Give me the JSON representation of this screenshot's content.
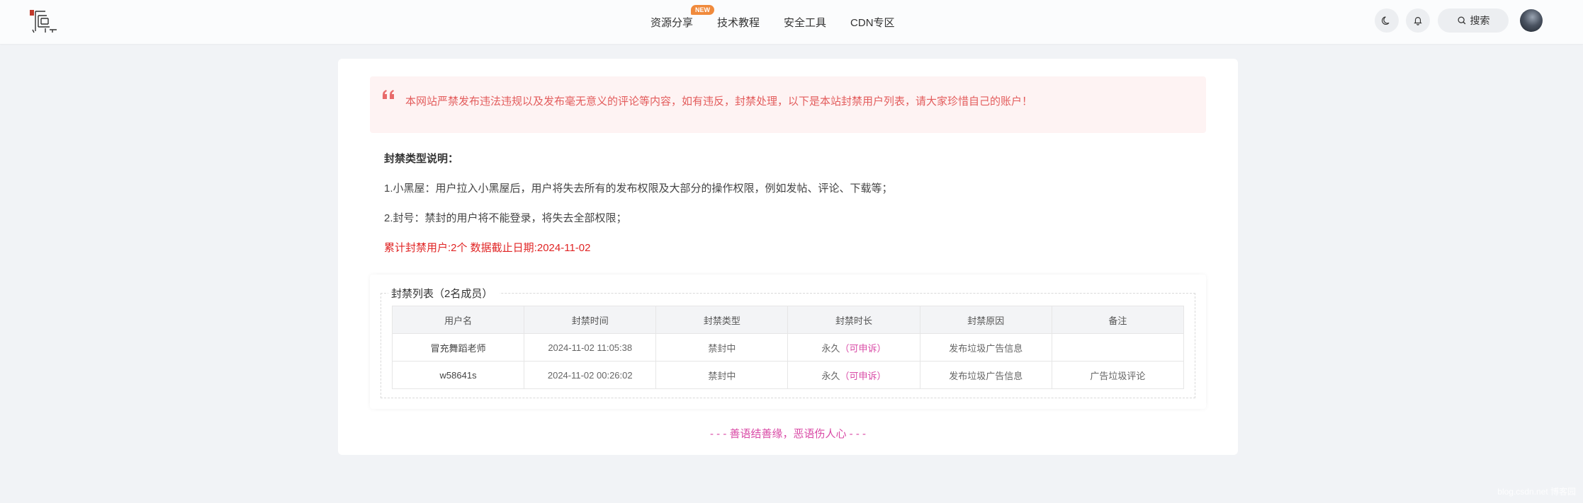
{
  "header": {
    "logo_text": "源",
    "nav": [
      {
        "label": "资源分享",
        "badge": "NEW"
      },
      {
        "label": "技术教程"
      },
      {
        "label": "安全工具"
      },
      {
        "label": "CDN专区"
      }
    ],
    "search_label": "搜索",
    "icons": [
      "moon-icon",
      "bell-icon",
      "search-icon"
    ]
  },
  "notice": {
    "text": "本网站严禁发布违法违规以及发布毫无意义的评论等内容，如有违反，封禁处理，以下是本站封禁用户列表，请大家珍惜自己的账户！"
  },
  "ban_types": {
    "title": "封禁类型说明：",
    "items": [
      "1.小黑屋：用户拉入小黑屋后，用户将失去所有的发布权限及大部分的操作权限，例如发帖、评论、下载等；",
      "2.封号：禁封的用户将不能登录，将失去全部权限；"
    ]
  },
  "stats": {
    "text": "累计封禁用户:2个 数据截止日期:2024-11-02"
  },
  "ban_list": {
    "legend": "封禁列表（2名成员）",
    "columns": [
      "用户名",
      "封禁时间",
      "封禁类型",
      "封禁时长",
      "封禁原因",
      "备注"
    ],
    "rows": [
      {
        "username": "冒充舞蹈老师",
        "time": "2024-11-02 11:05:38",
        "type": "禁封中",
        "duration": "永久",
        "appeal": "（可申诉）",
        "reason": "发布垃圾广告信息",
        "note": ""
      },
      {
        "username": "w58641s",
        "time": "2024-11-02 00:26:02",
        "type": "禁封中",
        "duration": "永久",
        "appeal": "（可申诉）",
        "reason": "发布垃圾广告信息",
        "note": "广告垃圾评论"
      }
    ]
  },
  "footer": {
    "slogan": "- - - 善语结善缘，恶语伤人心 - - -",
    "watermark": "blog.csdn.net 博客园"
  },
  "colors": {
    "notice_bg": "#fef3f3",
    "notice_text": "#e35c5c",
    "stat_red": "#e02424",
    "accent_pink": "#d94aa6",
    "badge_orange": "#f08a3c"
  }
}
